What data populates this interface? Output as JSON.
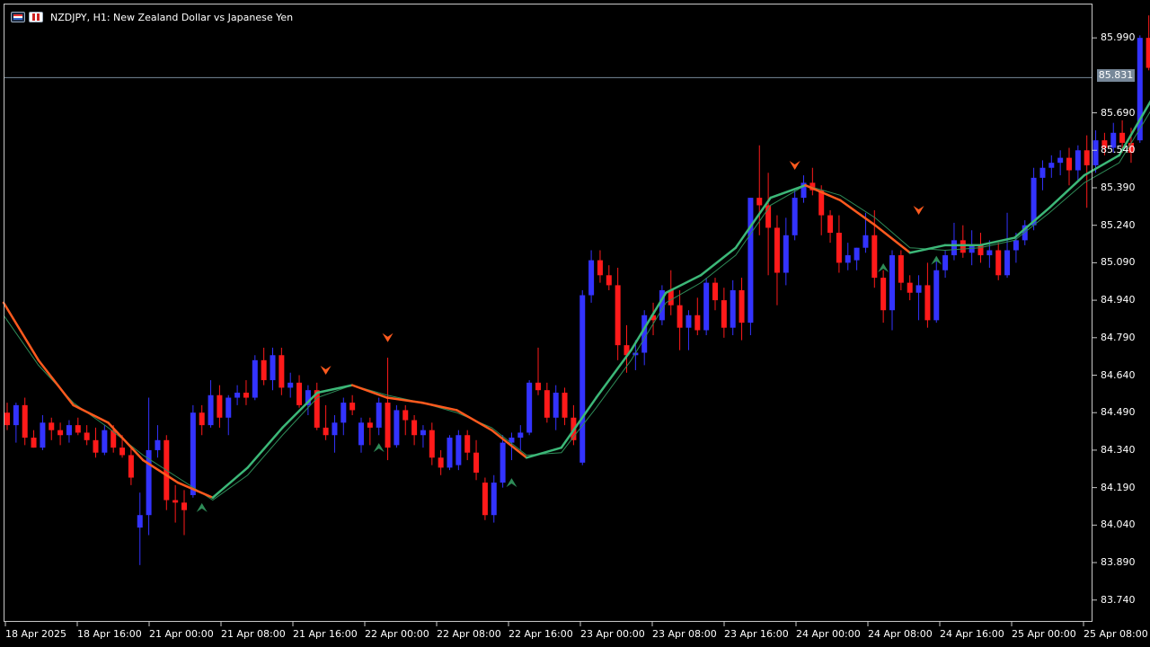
{
  "header": {
    "title": "NZDJPY, H1:  New Zealand Dollar vs Japanese Yen",
    "icon_left": "chart-window-icon",
    "icon_right": "expert-advisor-icon"
  },
  "current_price": "85.831",
  "colors": {
    "background": "#000000",
    "bull_candle": "#3333ff",
    "bear_candle": "#ff1a1a",
    "ma_down": "#ff5a1e",
    "ma_up": "#3cb878",
    "ma_thin": "#2e8b57",
    "signal_sell": "#ff5a1e",
    "signal_buy": "#2e8b57",
    "price_tag": "#778899"
  },
  "chart_data": {
    "type": "candlestick",
    "symbol": "NZDJPY",
    "timeframe": "H1",
    "y_ticks": [
      "85.990",
      "85.690",
      "85.540",
      "85.390",
      "85.240",
      "85.090",
      "84.940",
      "84.790",
      "84.640",
      "84.490",
      "84.340",
      "84.190",
      "84.040",
      "83.890",
      "83.740"
    ],
    "x_ticks": [
      "18 Apr 2025",
      "18 Apr 16:00",
      "21 Apr 00:00",
      "21 Apr 08:00",
      "21 Apr 16:00",
      "22 Apr 00:00",
      "22 Apr 08:00",
      "22 Apr 16:00",
      "23 Apr 00:00",
      "23 Apr 08:00",
      "23 Apr 16:00",
      "24 Apr 00:00",
      "24 Apr 08:00",
      "24 Apr 16:00",
      "25 Apr 00:00",
      "25 Apr 08:00"
    ],
    "ylim": [
      83.66,
      86.12
    ],
    "last_price": 85.831,
    "candles": [
      [
        84.49,
        84.53,
        84.42,
        84.44
      ],
      [
        84.44,
        84.53,
        84.37,
        84.52
      ],
      [
        84.52,
        84.55,
        84.36,
        84.39
      ],
      [
        84.39,
        84.42,
        84.35,
        84.35
      ],
      [
        84.35,
        84.48,
        84.34,
        84.45
      ],
      [
        84.45,
        84.47,
        84.38,
        84.42
      ],
      [
        84.42,
        84.45,
        84.36,
        84.4
      ],
      [
        84.4,
        84.46,
        84.37,
        84.44
      ],
      [
        84.44,
        84.47,
        84.4,
        84.41
      ],
      [
        84.41,
        84.44,
        84.36,
        84.38
      ],
      [
        84.38,
        84.43,
        84.31,
        84.33
      ],
      [
        84.33,
        84.44,
        84.32,
        84.42
      ],
      [
        84.42,
        84.44,
        84.33,
        84.35
      ],
      [
        84.35,
        84.4,
        84.31,
        84.32
      ],
      [
        84.32,
        84.35,
        84.2,
        84.23
      ],
      [
        84.03,
        84.17,
        83.88,
        84.08
      ],
      [
        84.08,
        84.55,
        84.0,
        84.34
      ],
      [
        84.34,
        84.44,
        84.31,
        84.38
      ],
      [
        84.38,
        84.4,
        84.1,
        84.14
      ],
      [
        84.14,
        84.2,
        84.05,
        84.13
      ],
      [
        84.13,
        84.18,
        84.0,
        84.1
      ],
      [
        84.16,
        84.52,
        84.15,
        84.49
      ],
      [
        84.49,
        84.52,
        84.4,
        84.44
      ],
      [
        84.44,
        84.62,
        84.43,
        84.56
      ],
      [
        84.56,
        84.6,
        84.43,
        84.47
      ],
      [
        84.47,
        84.56,
        84.4,
        84.55
      ],
      [
        84.55,
        84.6,
        84.52,
        84.57
      ],
      [
        84.57,
        84.62,
        84.52,
        84.55
      ],
      [
        84.55,
        84.72,
        84.54,
        84.7
      ],
      [
        84.7,
        84.75,
        84.6,
        84.62
      ],
      [
        84.62,
        84.75,
        84.58,
        84.72
      ],
      [
        84.72,
        84.75,
        84.56,
        84.59
      ],
      [
        84.59,
        84.65,
        84.55,
        84.61
      ],
      [
        84.61,
        84.64,
        84.51,
        84.52
      ],
      [
        84.52,
        84.6,
        84.48,
        84.58
      ],
      [
        84.58,
        84.61,
        84.42,
        84.43
      ],
      [
        84.43,
        84.52,
        84.38,
        84.4
      ],
      [
        84.4,
        84.48,
        84.33,
        84.45
      ],
      [
        84.45,
        84.55,
        84.4,
        84.53
      ],
      [
        84.53,
        84.56,
        84.48,
        84.5
      ],
      [
        84.36,
        84.47,
        84.33,
        84.45
      ],
      [
        84.45,
        84.47,
        84.36,
        84.43
      ],
      [
        84.43,
        84.55,
        84.4,
        84.53
      ],
      [
        84.53,
        84.71,
        84.3,
        84.35
      ],
      [
        84.36,
        84.52,
        84.35,
        84.5
      ],
      [
        84.5,
        84.52,
        84.4,
        84.46
      ],
      [
        84.46,
        84.48,
        84.36,
        84.4
      ],
      [
        84.4,
        84.44,
        84.35,
        84.42
      ],
      [
        84.42,
        84.45,
        84.28,
        84.31
      ],
      [
        84.31,
        84.34,
        84.24,
        84.27
      ],
      [
        84.27,
        84.4,
        84.26,
        84.39
      ],
      [
        84.28,
        84.42,
        84.26,
        84.4
      ],
      [
        84.4,
        84.42,
        84.3,
        84.33
      ],
      [
        84.33,
        84.38,
        84.22,
        84.25
      ],
      [
        84.21,
        84.23,
        84.06,
        84.08
      ],
      [
        84.08,
        84.24,
        84.05,
        84.21
      ],
      [
        84.21,
        84.4,
        84.19,
        84.37
      ],
      [
        84.37,
        84.41,
        84.3,
        84.39
      ],
      [
        84.39,
        84.44,
        84.34,
        84.41
      ],
      [
        84.41,
        84.62,
        84.4,
        84.61
      ],
      [
        84.61,
        84.75,
        84.56,
        84.58
      ],
      [
        84.58,
        84.61,
        84.45,
        84.47
      ],
      [
        84.47,
        84.6,
        84.42,
        84.57
      ],
      [
        84.57,
        84.59,
        84.44,
        84.47
      ],
      [
        84.47,
        84.52,
        84.36,
        84.38
      ],
      [
        84.29,
        84.98,
        84.28,
        84.96
      ],
      [
        84.96,
        85.14,
        84.93,
        85.1
      ],
      [
        85.1,
        85.14,
        85.01,
        85.04
      ],
      [
        85.04,
        85.08,
        84.98,
        85.0
      ],
      [
        85.0,
        85.07,
        84.7,
        84.76
      ],
      [
        84.76,
        84.84,
        84.65,
        84.72
      ],
      [
        84.72,
        84.78,
        84.66,
        84.73
      ],
      [
        84.73,
        84.9,
        84.68,
        84.88
      ],
      [
        84.88,
        84.93,
        84.8,
        84.86
      ],
      [
        84.86,
        85.0,
        84.84,
        84.98
      ],
      [
        84.98,
        85.06,
        84.88,
        84.92
      ],
      [
        84.92,
        84.98,
        84.74,
        84.83
      ],
      [
        84.83,
        84.9,
        84.74,
        84.88
      ],
      [
        84.88,
        84.95,
        84.8,
        84.82
      ],
      [
        84.82,
        85.03,
        84.8,
        85.01
      ],
      [
        85.01,
        85.03,
        84.9,
        84.94
      ],
      [
        84.94,
        84.99,
        84.79,
        84.83
      ],
      [
        84.83,
        85.02,
        84.8,
        84.98
      ],
      [
        84.98,
        85.03,
        84.78,
        84.85
      ],
      [
        84.85,
        85.35,
        84.8,
        85.35
      ],
      [
        85.35,
        85.56,
        85.2,
        85.32
      ],
      [
        85.32,
        85.45,
        85.04,
        85.23
      ],
      [
        85.23,
        85.28,
        84.92,
        85.05
      ],
      [
        85.05,
        85.27,
        85.0,
        85.2
      ],
      [
        85.2,
        85.38,
        85.18,
        85.35
      ],
      [
        85.35,
        85.44,
        85.33,
        85.41
      ],
      [
        85.41,
        85.47,
        85.36,
        85.38
      ],
      [
        85.38,
        85.4,
        85.2,
        85.28
      ],
      [
        85.28,
        85.3,
        85.17,
        85.21
      ],
      [
        85.21,
        85.28,
        85.05,
        85.09
      ],
      [
        85.09,
        85.17,
        85.06,
        85.12
      ],
      [
        85.1,
        85.15,
        85.06,
        85.15
      ],
      [
        85.15,
        85.29,
        85.13,
        85.2
      ],
      [
        85.2,
        85.3,
        84.99,
        85.03
      ],
      [
        85.03,
        85.06,
        84.85,
        84.9
      ],
      [
        84.9,
        85.14,
        84.82,
        85.12
      ],
      [
        85.12,
        85.14,
        84.98,
        85.01
      ],
      [
        85.01,
        85.04,
        84.94,
        84.97
      ],
      [
        84.97,
        85.04,
        84.86,
        85.0
      ],
      [
        85.0,
        85.09,
        84.83,
        84.86
      ],
      [
        84.86,
        85.11,
        84.85,
        85.06
      ],
      [
        85.06,
        85.14,
        85.03,
        85.12
      ],
      [
        85.12,
        85.25,
        85.1,
        85.18
      ],
      [
        85.18,
        85.24,
        85.11,
        85.13
      ],
      [
        85.13,
        85.22,
        85.08,
        85.16
      ],
      [
        85.16,
        85.21,
        85.09,
        85.12
      ],
      [
        85.12,
        85.18,
        85.07,
        85.14
      ],
      [
        85.14,
        85.17,
        85.02,
        85.04
      ],
      [
        85.04,
        85.29,
        85.03,
        85.14
      ],
      [
        85.14,
        85.21,
        85.09,
        85.18
      ],
      [
        85.18,
        85.26,
        85.16,
        85.24
      ],
      [
        85.24,
        85.47,
        85.22,
        85.43
      ],
      [
        85.43,
        85.5,
        85.38,
        85.47
      ],
      [
        85.47,
        85.52,
        85.43,
        85.49
      ],
      [
        85.49,
        85.54,
        85.44,
        85.51
      ],
      [
        85.51,
        85.55,
        85.4,
        85.46
      ],
      [
        85.46,
        85.56,
        85.42,
        85.54
      ],
      [
        85.54,
        85.6,
        85.31,
        85.48
      ],
      [
        85.48,
        85.62,
        85.45,
        85.58
      ],
      [
        85.58,
        85.61,
        85.52,
        85.55
      ],
      [
        85.55,
        85.65,
        85.53,
        85.61
      ],
      [
        85.61,
        85.66,
        85.53,
        85.57
      ],
      [
        85.57,
        85.63,
        85.49,
        85.53
      ],
      [
        85.58,
        86.0,
        85.57,
        85.99
      ],
      [
        85.99,
        86.08,
        85.86,
        85.87
      ],
      [
        85.87,
        85.91,
        85.81,
        85.831
      ]
    ],
    "ma_fast_points": [
      84.93,
      84.7,
      84.52,
      84.45,
      84.3,
      84.21,
      84.15,
      84.27,
      84.43,
      84.57,
      84.6,
      84.55,
      84.53,
      84.5,
      84.42,
      84.31,
      84.35,
      84.55,
      84.74,
      84.97,
      85.04,
      85.15,
      85.35,
      85.4,
      85.34,
      85.24,
      85.13,
      85.16,
      85.16,
      85.19,
      85.31,
      85.44,
      85.52,
      85.76
    ],
    "ma_slow_points": [
      84.88,
      84.68,
      84.53,
      84.43,
      84.32,
      84.23,
      84.14,
      84.24,
      84.4,
      84.55,
      84.6,
      84.56,
      84.53,
      84.49,
      84.43,
      84.32,
      84.33,
      84.51,
      84.7,
      84.93,
      85.01,
      85.12,
      85.32,
      85.4,
      85.36,
      85.27,
      85.15,
      85.14,
      85.15,
      85.18,
      85.29,
      85.41,
      85.49,
      85.72
    ],
    "sell_signals": [
      {
        "candle": 36,
        "price": 84.66
      },
      {
        "candle": 43,
        "price": 84.79
      },
      {
        "candle": 89,
        "price": 85.48
      },
      {
        "candle": 103,
        "price": 85.3
      }
    ],
    "buy_signals": [
      {
        "candle": 22,
        "price": 84.11
      },
      {
        "candle": 42,
        "price": 84.35
      },
      {
        "candle": 57,
        "price": 84.21
      },
      {
        "candle": 99,
        "price": 85.07
      },
      {
        "candle": 105,
        "price": 85.1
      }
    ],
    "grid": false,
    "legend": "none"
  }
}
